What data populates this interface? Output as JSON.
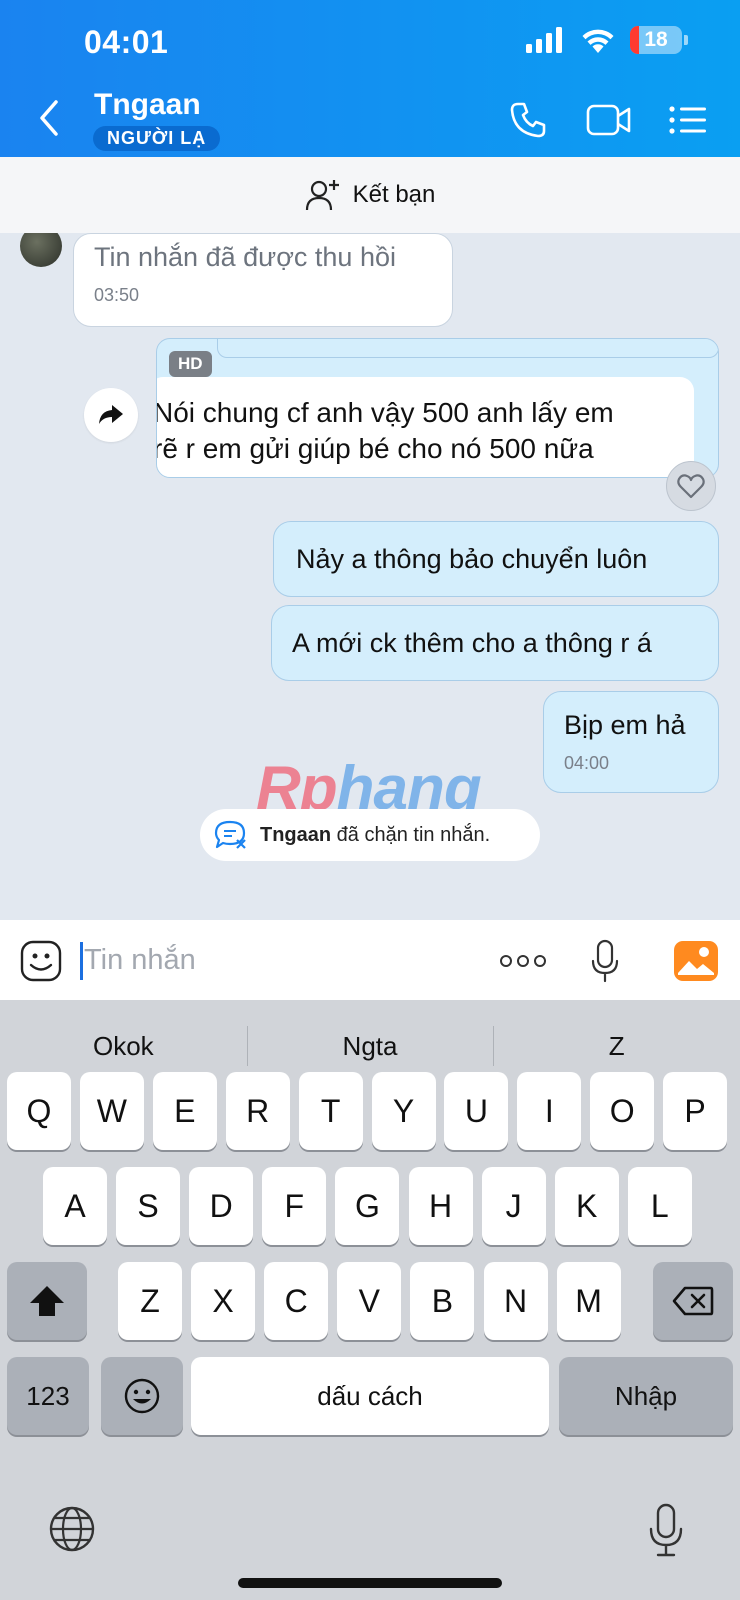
{
  "status_bar": {
    "time": "04:01",
    "battery": "18",
    "battery_level_percent": 18
  },
  "header": {
    "name": "Tngaan",
    "badge": "NGƯỜI LẠ"
  },
  "friend_bar": {
    "label": "Kết bạn"
  },
  "messages": {
    "recalled": {
      "text": "Tin nhắn đã được thu hồi",
      "time": "03:50"
    },
    "forwarded": {
      "badge": "HD",
      "line1": "Nói chung cf anh vậy 500 anh lấy em",
      "line2": "rẽ r em gửi giúp bé cho nó 500 nữa"
    },
    "m1": "Nảy a thông bảo chuyển luôn",
    "m2": "A mới ck thêm cho a thông r á",
    "m3": {
      "text": "Bịp em hả",
      "time": "04:00"
    }
  },
  "watermark": {
    "part1": "Rp",
    "part2": "hang"
  },
  "blocked_notice": {
    "name": "Tngaan",
    "text": " đã chặn tin nhắn."
  },
  "input": {
    "placeholder": "Tin nhắn",
    "value": ""
  },
  "keyboard": {
    "suggestions": [
      "Okok",
      "Ngta",
      "Z"
    ],
    "row1": [
      "Q",
      "W",
      "E",
      "R",
      "T",
      "Y",
      "U",
      "I",
      "O",
      "P"
    ],
    "row2": [
      "A",
      "S",
      "D",
      "F",
      "G",
      "H",
      "J",
      "K",
      "L"
    ],
    "row3": [
      "Z",
      "X",
      "C",
      "V",
      "B",
      "N",
      "M"
    ],
    "numbers_key": "123",
    "space": "dấu cách",
    "return": "Nhập"
  },
  "colors": {
    "header_blue": "#1a83f0",
    "bubble_out": "#d4eefc",
    "accent_orange": "#ff8a1f"
  }
}
